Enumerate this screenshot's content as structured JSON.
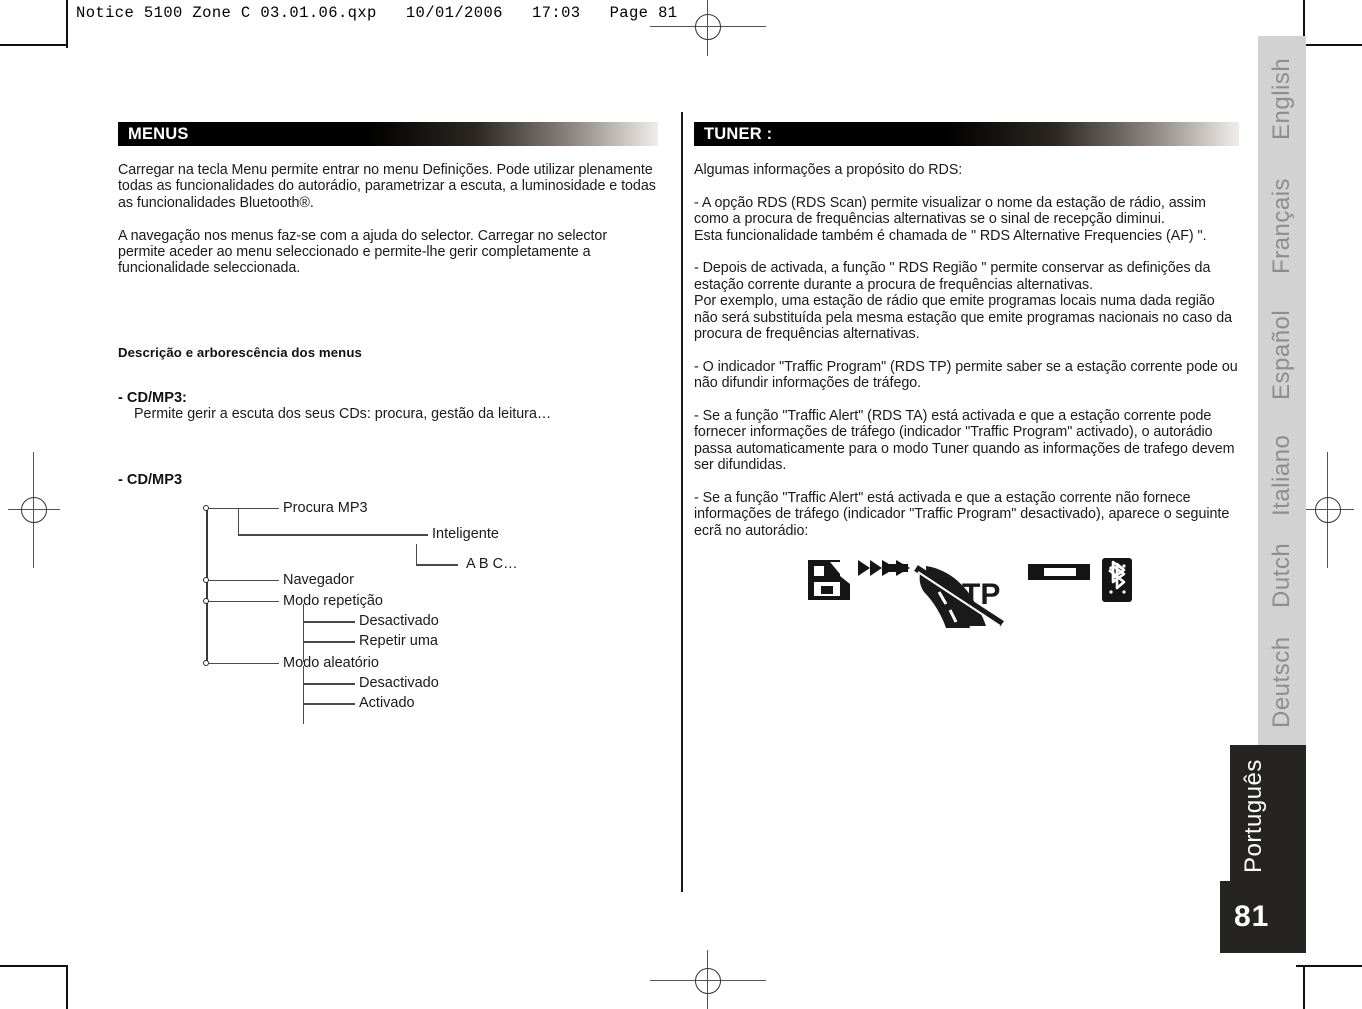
{
  "slug": {
    "text": "Notice 5100 Zone C 03.01.06.qxp   10/01/2006   17:03   Page 81"
  },
  "left_column": {
    "section_title": "MENUS",
    "paragraphs": [
      "Carregar na tecla Menu permite entrar no menu Definições. Pode utilizar plenamente todas as funcionalidades do autorádio, parametrizar a escuta, a luminosidade e todas as funcionalidades Bluetooth®.",
      "A navegação nos menus faz-se com a ajuda do selector. Carregar no selector permite aceder ao menu seleccionado e permite-lhe gerir completamente a funcionalidade seleccionada."
    ],
    "sub_heading": "Descrição e arborescência dos menus",
    "item_heading": "- CD/MP3:",
    "item_description": "Permite gerir a escuta dos seus CDs: procura, gestão da leitura…",
    "tree_heading": "- CD/MP3",
    "tree": {
      "nodes": [
        {
          "label": "Procura MP3",
          "level": 1
        },
        {
          "label": "Inteligente",
          "level": 2
        },
        {
          "label": "A B C…",
          "level": 3
        },
        {
          "label": "Navegador",
          "level": 1
        },
        {
          "label": "Modo repetição",
          "level": 1
        },
        {
          "label": "Desactivado",
          "level": 2
        },
        {
          "label": "Repetir uma",
          "level": 2
        },
        {
          "label": "Modo aleatório",
          "level": 1
        },
        {
          "label": "Desactivado",
          "level": 2
        },
        {
          "label": "Activado",
          "level": 2
        }
      ]
    }
  },
  "right_column": {
    "section_title": "TUNER :",
    "intro": "Algumas informações a propósito do RDS:",
    "paragraphs": [
      "- A opção RDS (RDS Scan) permite visualizar o nome da estação de rádio, assim como a procura de frequências alternativas se o sinal de recepção diminui.\nEsta funcionalidade também é chamada de \" RDS Alternative Frequencies (AF) \".",
      "- Depois de activada, a função \" RDS Região \" permite conservar as definições da estação corrente durante a procura de frequências alternativas.\nPor exemplo, uma estação de rádio que emite programas locais numa dada região não será substituída pela mesma estação que emite programas nacionais no caso da procura de frequências alternativas.",
      "- O indicador \"Traffic Program\" (RDS TP) permite saber se a estação corrente pode ou não difundir informações de tráfego.",
      "- Se a função \"Traffic Alert\" (RDS TA) está activada e que a estação corrente pode fornecer informações de tráfego (indicador \"Traffic Program\" activado), o autorádio passa automaticamente para o modo Tuner quando as informações de trafego devem ser difundidas.",
      "- Se a função \"Traffic Alert\" está activada e que a estação corrente não fornece informações de tráfego (indicador \"Traffic Program\" desactivado), aparece o seguinte ecrã no autorádio:"
    ],
    "lcd_icons": [
      {
        "name": "disc-folder-icon"
      },
      {
        "name": "fast-forward-arrows-icon"
      },
      {
        "name": "traffic-program-crossed-out-icon",
        "label": "TP"
      },
      {
        "name": "signal-bar-icon"
      },
      {
        "name": "bluetooth-icon"
      }
    ]
  },
  "sidebar": {
    "languages": [
      {
        "label": "English",
        "active": false
      },
      {
        "label": "Français",
        "active": false
      },
      {
        "label": "Español",
        "active": false
      },
      {
        "label": "Italiano",
        "active": false
      },
      {
        "label": "Dutch",
        "active": false
      },
      {
        "label": "Deutsch",
        "active": false
      },
      {
        "label": "Português",
        "active": true
      }
    ],
    "page_number": "81"
  },
  "colors": {
    "bar_start": "#000000",
    "bar_end": "#efeceb",
    "sidebar_band": "#d2d2d2",
    "active_tab": "#262323",
    "text": "#1a1a1a"
  }
}
